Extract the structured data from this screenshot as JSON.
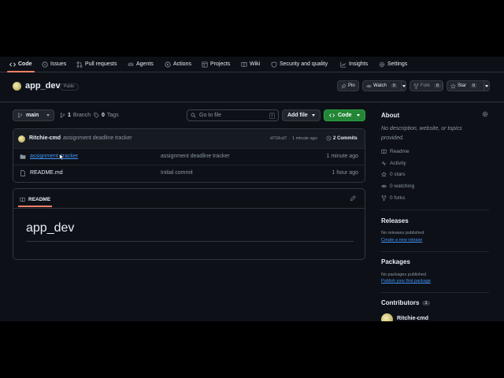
{
  "nav": {
    "tabs": [
      {
        "label": "Code",
        "icon": "code-icon",
        "selected": true
      },
      {
        "label": "Issues",
        "icon": "issue-icon"
      },
      {
        "label": "Pull requests",
        "icon": "pull-request-icon"
      },
      {
        "label": "Agents",
        "icon": "agent-icon"
      },
      {
        "label": "Actions",
        "icon": "play-icon"
      },
      {
        "label": "Projects",
        "icon": "table-icon"
      },
      {
        "label": "Wiki",
        "icon": "book-icon"
      },
      {
        "label": "Security and quality",
        "icon": "shield-icon"
      },
      {
        "label": "Insights",
        "icon": "graph-icon"
      },
      {
        "label": "Settings",
        "icon": "gear-icon"
      }
    ]
  },
  "repo": {
    "name": "app_dev",
    "visibility": "Public",
    "pin_label": "Pin",
    "watch_label": "Watch",
    "watch_count": "0",
    "fork_label": "Fork",
    "fork_count": "0",
    "star_label": "Star",
    "star_count": "0"
  },
  "toolbar": {
    "branch": "main",
    "branch_count": "1",
    "branch_label": "Branch",
    "tag_count": "0",
    "tag_label": "Tags",
    "search_placeholder": "Go to file",
    "search_shortcut": "t",
    "add_file_label": "Add file",
    "code_label": "Code"
  },
  "commit": {
    "author": "Ritchie-cmd",
    "message": "assignment deadline tracker",
    "hash": "d718cd7",
    "time": "1 minute ago",
    "commit_count_label": "2 Commits"
  },
  "files": [
    {
      "name": "assignment_tracker",
      "type": "folder",
      "message": "assignment deadline tracker",
      "time": "1 minute ago"
    },
    {
      "name": "README.md",
      "type": "file",
      "message": "Initial commit",
      "time": "1 hour ago"
    }
  ],
  "readme": {
    "tab_label": "README",
    "heading": "app_dev"
  },
  "about": {
    "title": "About",
    "description": "No description, website, or topics provided.",
    "items": [
      {
        "icon": "book-icon",
        "label": "Readme"
      },
      {
        "icon": "pulse-icon",
        "label": "Activity"
      },
      {
        "icon": "star-icon",
        "label": "0 stars"
      },
      {
        "icon": "eye-icon",
        "label": "0 watching"
      },
      {
        "icon": "fork-icon",
        "label": "0 forks"
      }
    ]
  },
  "releases": {
    "title": "Releases",
    "empty": "No releases published",
    "link": "Create a new release"
  },
  "packages": {
    "title": "Packages",
    "empty": "No packages published",
    "link": "Publish your first package"
  },
  "contributors": {
    "title": "Contributors",
    "count": "1",
    "name": "Ritchie-cmd"
  },
  "colors": {
    "background": "#0d1117",
    "border": "#30363d",
    "accent_green": "#238636",
    "link": "#4493f8",
    "tab_underline": "#f78166"
  }
}
